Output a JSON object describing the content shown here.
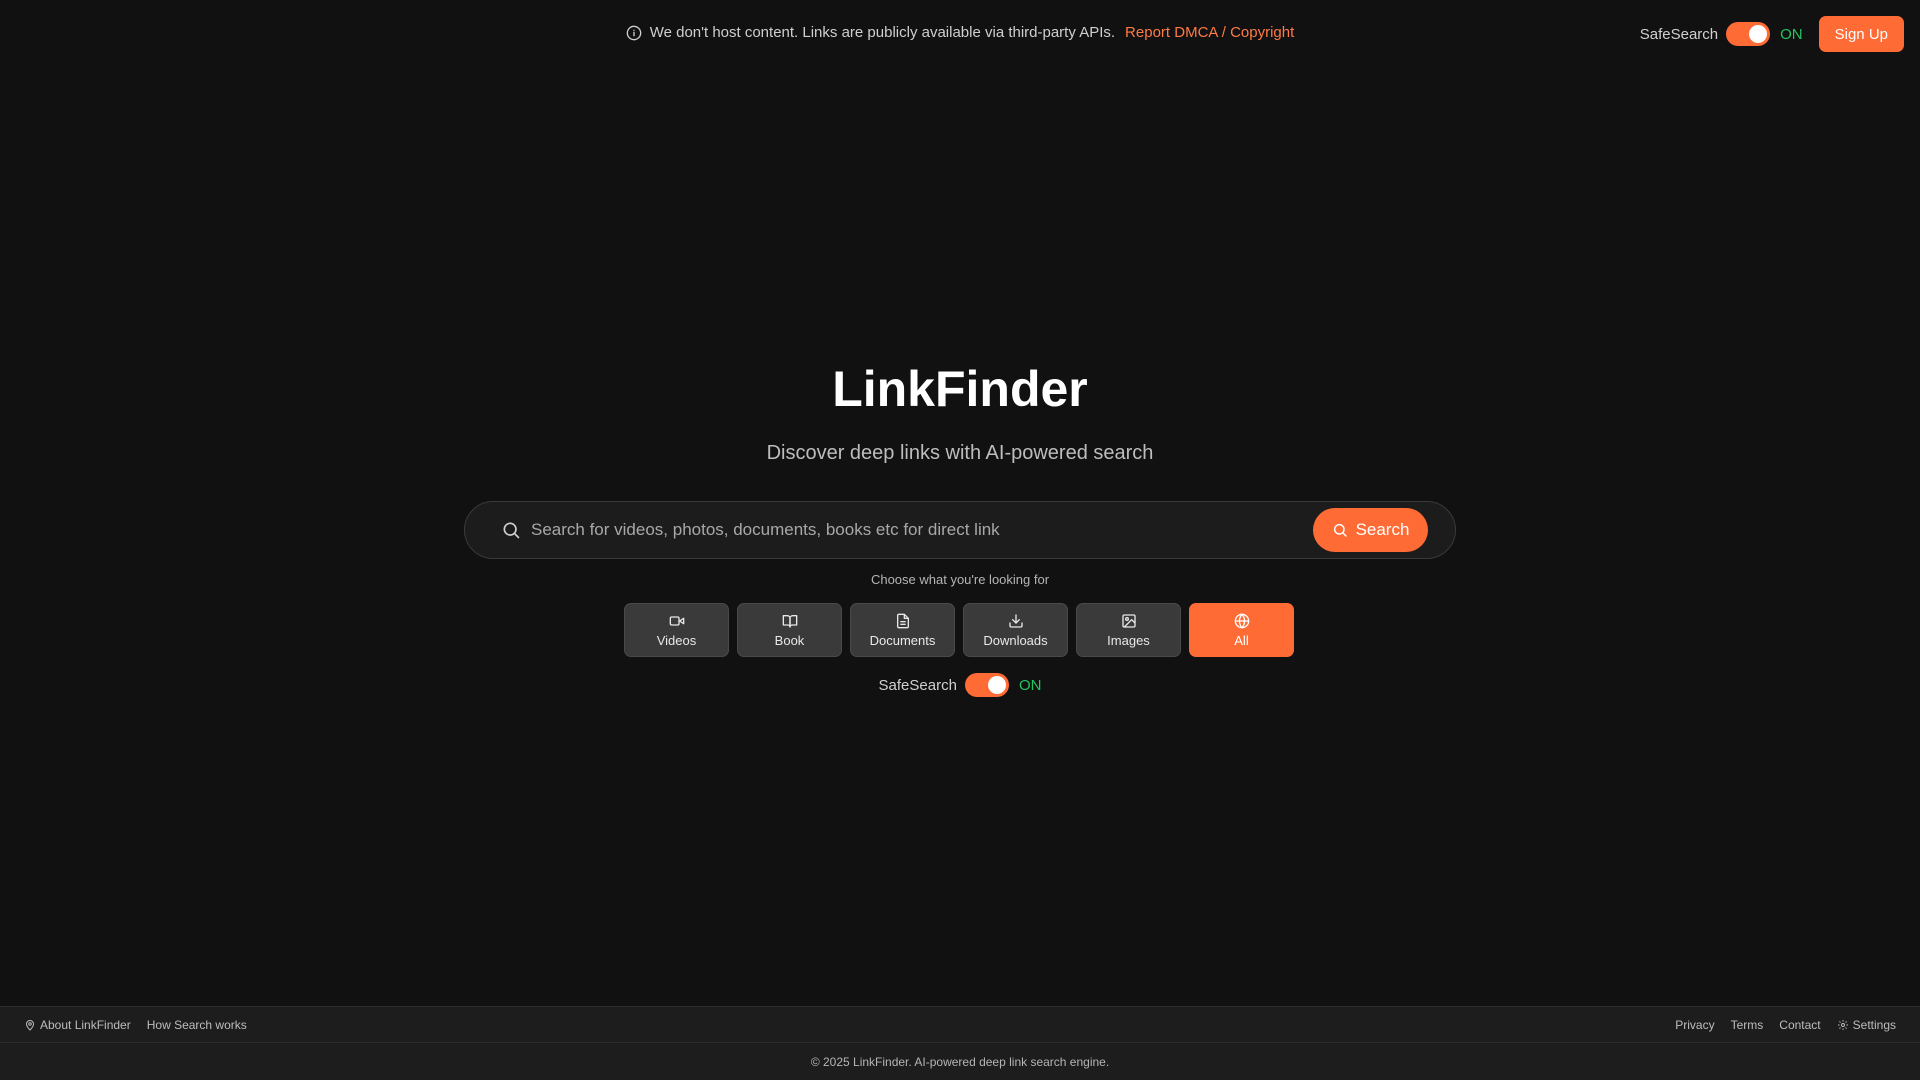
{
  "notice": {
    "icon": "info-icon",
    "text": "We don't host content. Links are publicly available via third-party APIs.",
    "link": "Report DMCA / Copyright"
  },
  "header": {
    "safesearch_label": "SafeSearch",
    "safesearch_state": "ON",
    "signup_label": "Sign Up"
  },
  "hero": {
    "title": "LinkFinder",
    "subtitle": "Discover deep links with AI-powered search"
  },
  "search": {
    "placeholder": "Search for videos, photos, documents, books etc for direct link",
    "value": "",
    "button_label": "Search"
  },
  "categories": {
    "prompt": "Choose what you're looking for",
    "items": [
      {
        "label": "Videos",
        "icon": "video-icon",
        "active": false
      },
      {
        "label": "Book",
        "icon": "book-icon",
        "active": false
      },
      {
        "label": "Documents",
        "icon": "document-icon",
        "active": false
      },
      {
        "label": "Downloads",
        "icon": "download-icon",
        "active": false
      },
      {
        "label": "Images",
        "icon": "image-icon",
        "active": false
      },
      {
        "label": "All",
        "icon": "globe-icon",
        "active": true
      }
    ]
  },
  "safesearch_main": {
    "label": "SafeSearch",
    "state": "ON"
  },
  "footer": {
    "about": "About LinkFinder",
    "how": "How Search works",
    "privacy": "Privacy",
    "terms": "Terms",
    "contact": "Contact",
    "settings": "Settings",
    "copyright": "© 2025 LinkFinder. AI-powered deep link search engine."
  },
  "colors": {
    "accent": "#ff6b35",
    "on_green": "#22c55e",
    "background": "#111111"
  }
}
